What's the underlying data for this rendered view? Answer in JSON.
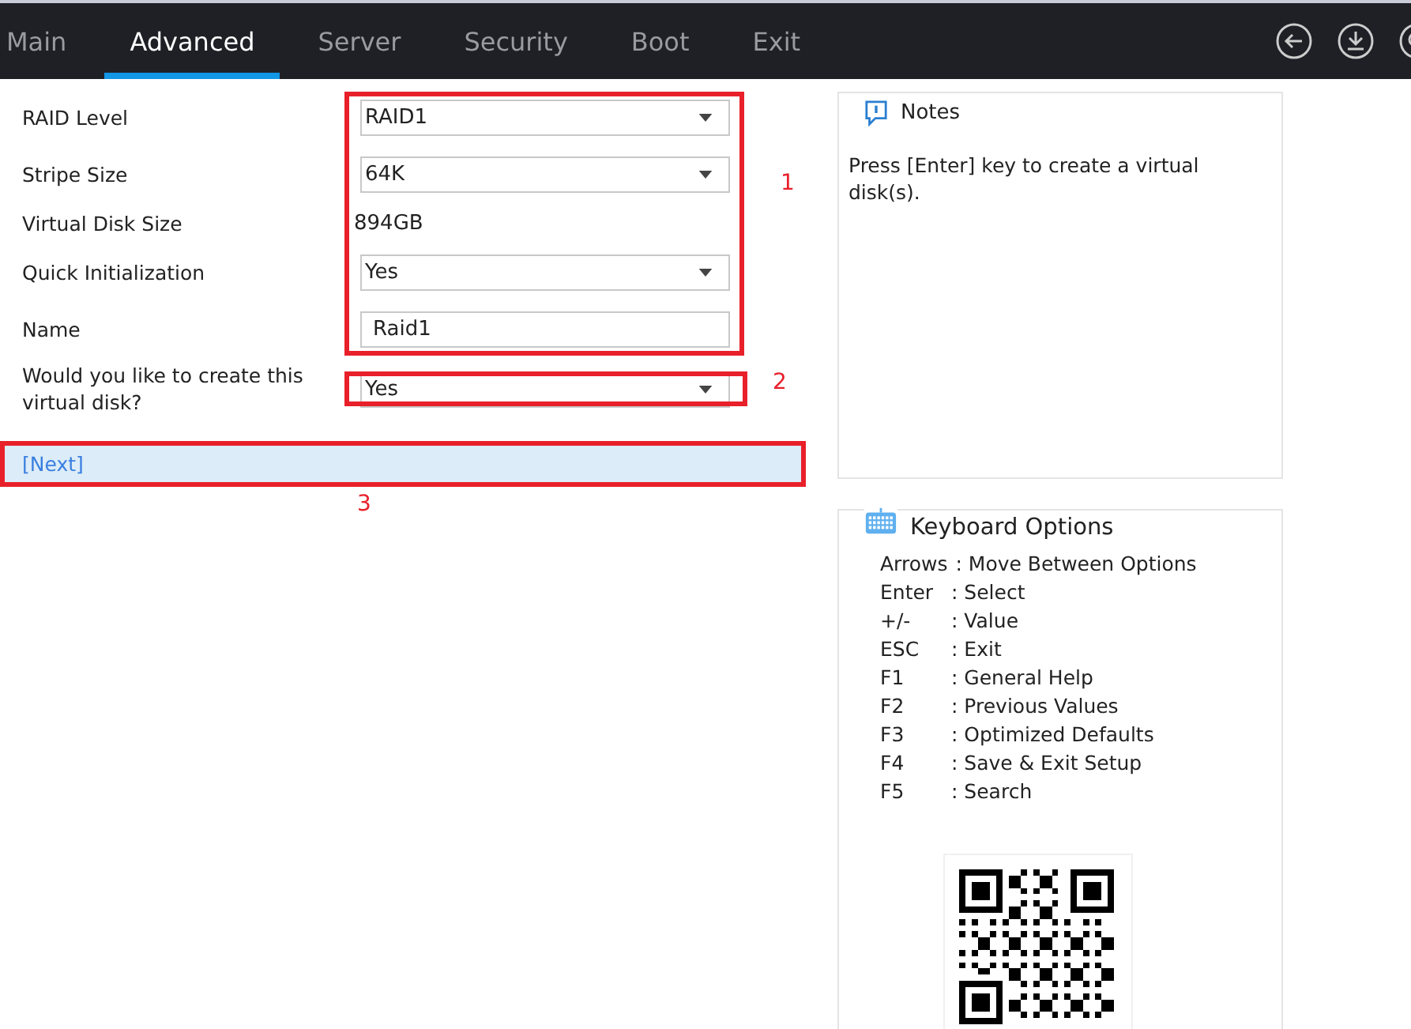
{
  "tabs": [
    {
      "label": "Main",
      "selected": false
    },
    {
      "label": "Advanced",
      "selected": true
    },
    {
      "label": "Server",
      "selected": false
    },
    {
      "label": "Security",
      "selected": false
    },
    {
      "label": "Boot",
      "selected": false
    },
    {
      "label": "Exit",
      "selected": false
    }
  ],
  "form": {
    "fields": [
      {
        "kind": "select",
        "label": "RAID Level",
        "value": "RAID1"
      },
      {
        "kind": "select",
        "label": "Stripe Size",
        "value": "64K"
      },
      {
        "kind": "text",
        "label": "Virtual Disk Size",
        "value": "894GB"
      },
      {
        "kind": "select",
        "label": "Quick Initialization",
        "value": "Yes"
      },
      {
        "kind": "input",
        "label": "Name",
        "value": "Raid1"
      },
      {
        "kind": "select",
        "label": "Would you like to create this virtual disk?",
        "value": "Yes"
      }
    ],
    "next": {
      "label": "[Next]",
      "selected": true
    }
  },
  "annotations": [
    {
      "number": "1"
    },
    {
      "number": "2"
    },
    {
      "number": "3"
    }
  ],
  "notes": {
    "title": "Notes",
    "text": "Press [Enter] key to create a virtual disk(s)."
  },
  "keyboard_options": {
    "title": "Keyboard Options",
    "items": [
      {
        "key": "Arrows",
        "action": ": Move Between Options"
      },
      {
        "key": "Enter",
        "action": ": Select"
      },
      {
        "key": "+/-",
        "action": ": Value"
      },
      {
        "key": "ESC",
        "action": ": Exit"
      },
      {
        "key": "F1",
        "action": ": General Help"
      },
      {
        "key": "F2",
        "action": ": Previous Values"
      },
      {
        "key": "F3",
        "action": ": Optimized Defaults"
      },
      {
        "key": "F4",
        "action": ": Save & Exit Setup"
      },
      {
        "key": "F5",
        "action": ": Search"
      }
    ]
  }
}
